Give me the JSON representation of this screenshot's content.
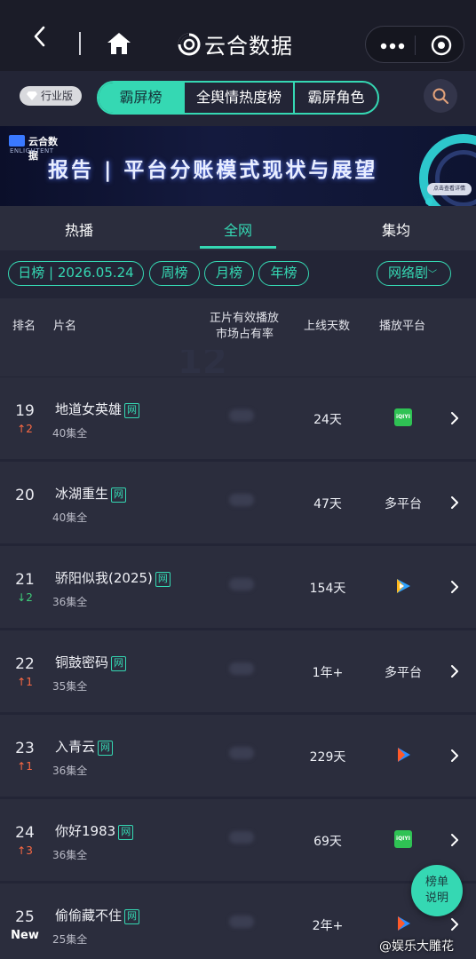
{
  "titlebar": {
    "title": "云合数据"
  },
  "filters": {
    "industry_label": "行业版",
    "segments": [
      "霸屏榜",
      "全舆情热度榜",
      "霸屏角色"
    ],
    "active_segment": 0
  },
  "banner": {
    "logo_cn": "云合数据",
    "logo_en": "ENLIGHTENT",
    "headline": "报告 | 平台分账模式现状与展望",
    "cta": "点击查看详情"
  },
  "tabs": [
    "热播",
    "全网",
    "集均"
  ],
  "active_tab": 1,
  "chips": {
    "date": "日榜 | 2026.05.24",
    "week": "周榜",
    "month": "月榜",
    "year": "年榜",
    "category": "网络剧"
  },
  "header": {
    "rank": "排名",
    "title": "片名",
    "share_line1": "正片有效播放",
    "share_line2": "市场占有率",
    "days": "上线天数",
    "platform": "播放平台"
  },
  "badge": "网",
  "rows": [
    {
      "rank": "19",
      "trend": "↑2",
      "trend_type": "up",
      "title": "地道女英雄",
      "episodes": "40集全",
      "days": "24天",
      "platform": "iqiyi-icon",
      "platform_text": "",
      "iqiyi_label": "iQIYI"
    },
    {
      "rank": "20",
      "trend": "",
      "trend_type": "none",
      "title": "冰湖重生",
      "episodes": "40集全",
      "days": "47天",
      "platform": "",
      "platform_text": "多平台"
    },
    {
      "rank": "21",
      "trend": "↓2",
      "trend_type": "down",
      "title": "骄阳似我(2025)",
      "episodes": "36集全",
      "days": "154天",
      "platform": "tencent-video-icon",
      "platform_text": ""
    },
    {
      "rank": "22",
      "trend": "↑1",
      "trend_type": "up",
      "title": "铜鼓密码",
      "episodes": "35集全",
      "days": "1年+",
      "platform": "",
      "platform_text": "多平台"
    },
    {
      "rank": "23",
      "trend": "↑1",
      "trend_type": "up",
      "title": "入青云",
      "episodes": "36集全",
      "days": "229天",
      "platform": "youku-icon",
      "platform_text": ""
    },
    {
      "rank": "24",
      "trend": "↑3",
      "trend_type": "up",
      "title": "你好1983",
      "episodes": "36集全",
      "days": "69天",
      "platform": "iqiyi-icon",
      "platform_text": "",
      "iqiyi_label": "iQIYI"
    },
    {
      "rank": "25",
      "trend": "New",
      "trend_type": "new",
      "title": "偷偷藏不住",
      "episodes": "25集全",
      "days": "2年+",
      "platform": "youku-icon",
      "platform_text": ""
    }
  ],
  "help_button": {
    "line1": "榜单",
    "line2": "说明"
  },
  "watermark": "@娱乐大雕花",
  "colors": {
    "accent": "#35d8b3",
    "background": "#232536",
    "up": "#ff6a43",
    "down": "#3fcf7a"
  }
}
